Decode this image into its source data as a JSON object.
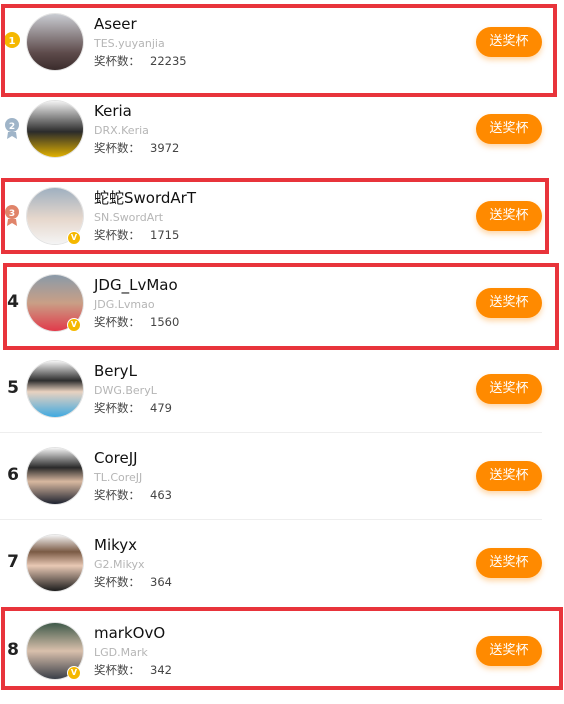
{
  "players": [
    {
      "rank": "1",
      "name": "Aseer",
      "team": "TES.yuyanjia",
      "cups_label": "奖杯数：",
      "cups": "22235",
      "button": "送奖杯"
    },
    {
      "rank": "2",
      "name": "Keria",
      "team": "DRX.Keria",
      "cups_label": "奖杯数：",
      "cups": "3972",
      "button": "送奖杯"
    },
    {
      "rank": "3",
      "name": "蛇蛇SwordArT",
      "team": "SN.SwordArt",
      "cups_label": "奖杯数：",
      "cups": "1715",
      "button": "送奖杯"
    },
    {
      "rank": "4",
      "name": "JDG_LvMao",
      "team": "JDG.Lvmao",
      "cups_label": "奖杯数：",
      "cups": "1560",
      "button": "送奖杯"
    },
    {
      "rank": "5",
      "name": "BeryL",
      "team": "DWG.BeryL",
      "cups_label": "奖杯数：",
      "cups": "479",
      "button": "送奖杯"
    },
    {
      "rank": "6",
      "name": "CoreJJ",
      "team": "TL.CoreJJ",
      "cups_label": "奖杯数：",
      "cups": "463",
      "button": "送奖杯"
    },
    {
      "rank": "7",
      "name": "Mikyx",
      "team": "G2.Mikyx",
      "cups_label": "奖杯数：",
      "cups": "364",
      "button": "送奖杯"
    },
    {
      "rank": "8",
      "name": "markOvO",
      "team": "LGD.Mark",
      "cups_label": "奖杯数：",
      "cups": "342",
      "button": "送奖杯"
    }
  ],
  "colors": {
    "button": "#ff8a00",
    "highlight": "#e8343b",
    "gold": "#f5b800",
    "silver": "#9fb4c8",
    "bronze": "#e0846a"
  }
}
